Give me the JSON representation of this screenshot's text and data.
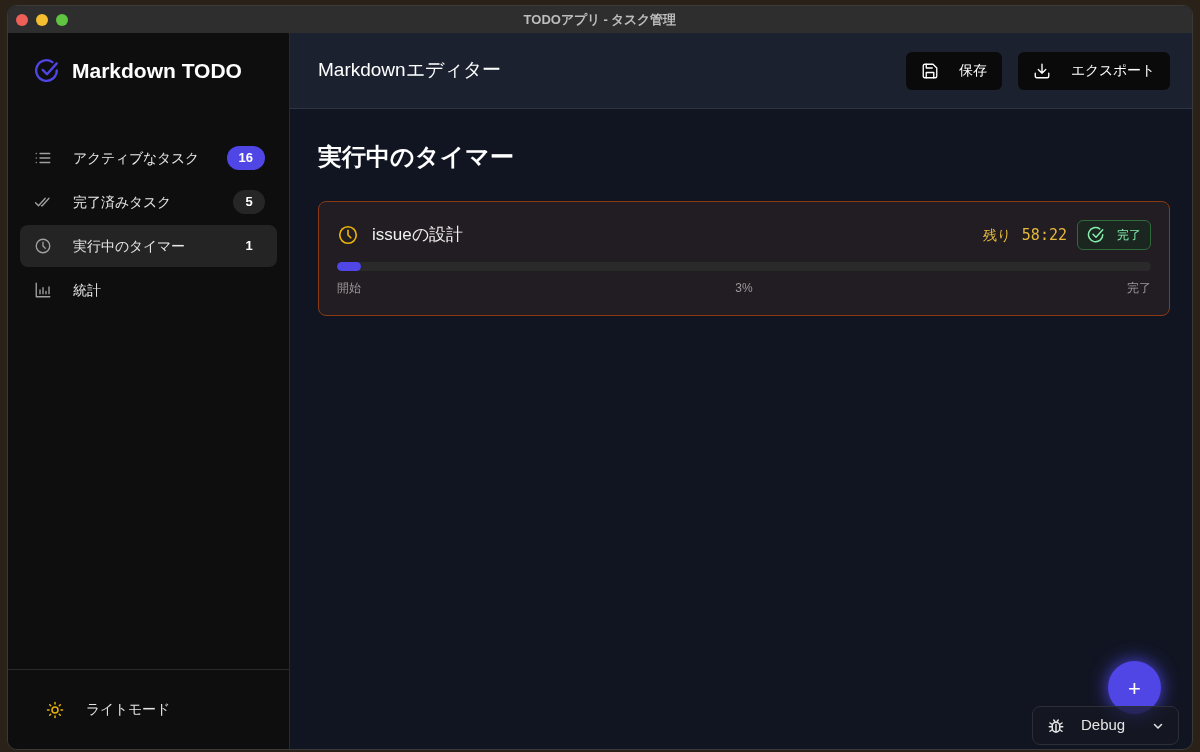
{
  "window": {
    "title": "TODOアプリ - タスク管理"
  },
  "sidebar": {
    "app_name": "Markdown TODO",
    "items": [
      {
        "label": "アクティブなタスク",
        "count": "16",
        "selected": false
      },
      {
        "label": "完了済みタスク",
        "count": "5",
        "selected": false
      },
      {
        "label": "実行中のタイマー",
        "count": "1",
        "selected": true
      },
      {
        "label": "統計",
        "selected": false
      }
    ],
    "theme_toggle": "ライトモード"
  },
  "header": {
    "title": "Markdownエディター",
    "buttons": [
      {
        "label": "保存"
      },
      {
        "label": "エクスポート"
      }
    ]
  },
  "content": {
    "heading": "実行中のタイマー",
    "timers": [
      {
        "title": "issueの設計",
        "remaining_label": "残り",
        "remaining": "58:22",
        "complete_button": "完了",
        "level": 0.03,
        "start_label": "開始",
        "percent": "3%",
        "end_label": "完了"
      }
    ]
  },
  "fab": {
    "label": "+"
  },
  "debug_menu": {
    "label": "Debug"
  }
}
